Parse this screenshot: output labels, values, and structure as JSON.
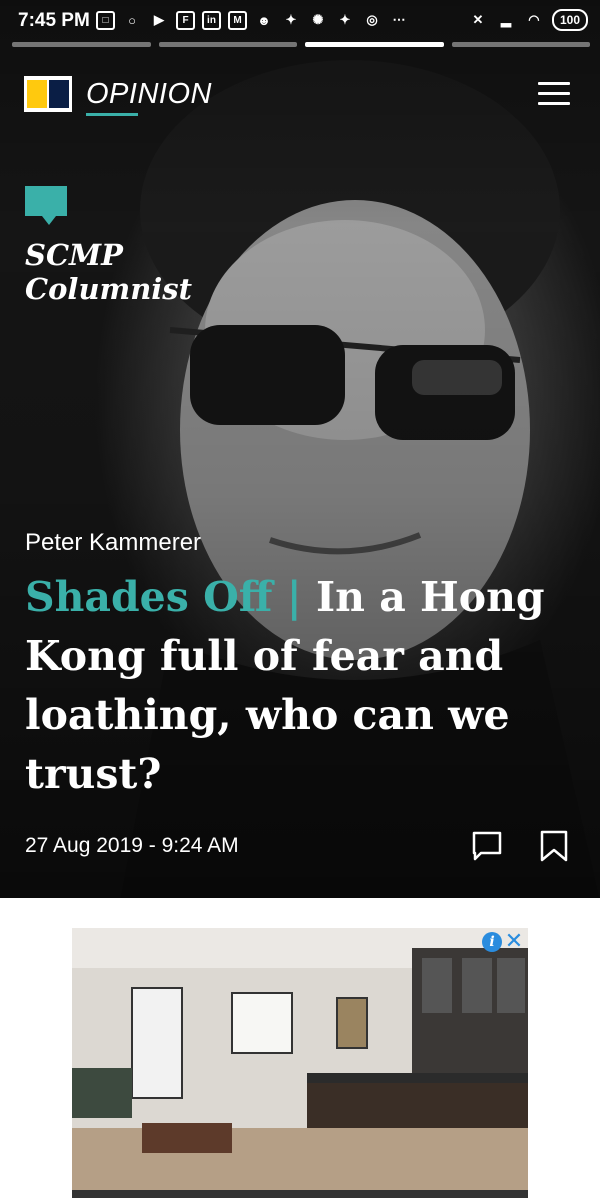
{
  "status_bar": {
    "time": "7:45 PM",
    "battery": "100"
  },
  "nav": {
    "section": "OPINION"
  },
  "badge": {
    "line1": "SCMP",
    "line2": "Columnist"
  },
  "article": {
    "author": "Peter Kammerer",
    "kicker": "Shades Off |",
    "title": "In a Hong Kong full of fear and loathing, who can we trust?",
    "date": "27 Aug 2019 - 9:24 AM"
  },
  "colors": {
    "accent": "#3ab0a9",
    "logo_yellow": "#ffc90e",
    "logo_navy": "#0a1e45",
    "ad_choices": "#2a8cde"
  },
  "icons": [
    "menu-icon",
    "comment-icon",
    "bookmark-icon",
    "ad-info-icon",
    "ad-close-icon"
  ]
}
